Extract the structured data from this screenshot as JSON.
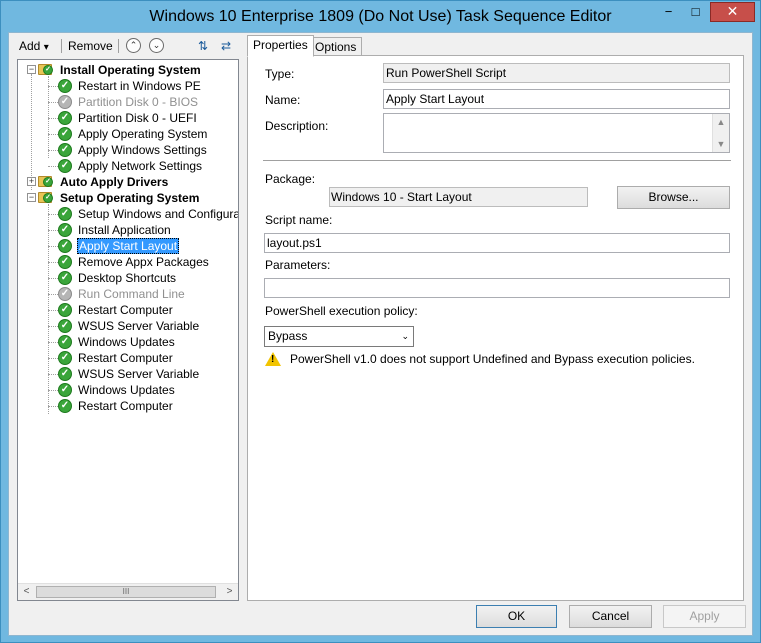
{
  "window": {
    "title": "Windows 10 Enterprise 1809 (Do Not Use) Task Sequence Editor",
    "minimize_glyph": "−",
    "maximize_glyph": "□",
    "close_glyph": "✕"
  },
  "toolbar": {
    "add_label": "Add",
    "add_arrow": "▾",
    "remove_label": "Remove",
    "move_up_glyph": "⌃",
    "move_down_glyph": "⌄",
    "icon1_glyph": "⇅",
    "icon2_glyph": "⇄"
  },
  "tree": {
    "items": [
      {
        "label": "Install Operating System",
        "type": "group",
        "status": "expanded"
      },
      {
        "label": "Restart in Windows PE",
        "type": "step",
        "status": "enabled"
      },
      {
        "label": "Partition Disk 0 - BIOS",
        "type": "step",
        "status": "disabled"
      },
      {
        "label": "Partition Disk 0 - UEFI",
        "type": "step",
        "status": "enabled"
      },
      {
        "label": "Apply Operating System",
        "type": "step",
        "status": "enabled"
      },
      {
        "label": "Apply Windows Settings",
        "type": "step",
        "status": "enabled"
      },
      {
        "label": "Apply Network Settings",
        "type": "step",
        "status": "enabled"
      },
      {
        "label": "Auto Apply Drivers",
        "type": "group",
        "status": "collapsed"
      },
      {
        "label": "Setup Operating System",
        "type": "group",
        "status": "expanded"
      },
      {
        "label": "Setup Windows and Configuration",
        "type": "step",
        "status": "enabled"
      },
      {
        "label": "Install Application",
        "type": "step",
        "status": "enabled"
      },
      {
        "label": "Apply Start Layout",
        "type": "step",
        "status": "selected"
      },
      {
        "label": "Remove Appx Packages",
        "type": "step",
        "status": "enabled"
      },
      {
        "label": "Desktop Shortcuts",
        "type": "step",
        "status": "enabled"
      },
      {
        "label": "Run Command Line",
        "type": "step",
        "status": "disabled"
      },
      {
        "label": "Restart Computer",
        "type": "step",
        "status": "enabled"
      },
      {
        "label": "WSUS Server Variable",
        "type": "step",
        "status": "enabled"
      },
      {
        "label": "Windows Updates",
        "type": "step",
        "status": "enabled"
      },
      {
        "label": "Restart Computer",
        "type": "step",
        "status": "enabled"
      },
      {
        "label": "WSUS Server Variable",
        "type": "step",
        "status": "enabled"
      },
      {
        "label": "Windows Updates",
        "type": "step",
        "status": "enabled"
      },
      {
        "label": "Restart Computer",
        "type": "step",
        "status": "enabled"
      }
    ],
    "scroll_left": "<",
    "scroll_right": ">",
    "scroll_grip": "III"
  },
  "tabs": [
    {
      "label": "Properties",
      "active": true
    },
    {
      "label": "Options",
      "active": false
    }
  ],
  "properties": {
    "type_label": "Type:",
    "type_value": "Run PowerShell Script",
    "name_label": "Name:",
    "name_value": "Apply Start Layout",
    "description_label": "Description:",
    "description_value": "",
    "package_label": "Package:",
    "package_value": "Windows 10 - Start Layout",
    "browse_label": "Browse...",
    "script_name_label": "Script name:",
    "script_name_value": "layout.ps1",
    "parameters_label": "Parameters:",
    "parameters_value": "",
    "policy_label": "PowerShell execution policy:",
    "policy_value": "Bypass",
    "policy_arrow": "⌄",
    "warning_text": "PowerShell v1.0 does not support Undefined and Bypass execution policies.",
    "warning_icon": "warning-icon",
    "warning_glyph": "!"
  },
  "footer": {
    "ok_label": "OK",
    "cancel_label": "Cancel",
    "apply_label": "Apply"
  },
  "colors": {
    "title_bar": "#70b8e0",
    "selection": "#3399ff",
    "check_enabled": "#3aa53a",
    "check_disabled": "#b5b5b5",
    "close_button": "#c74f4a"
  }
}
